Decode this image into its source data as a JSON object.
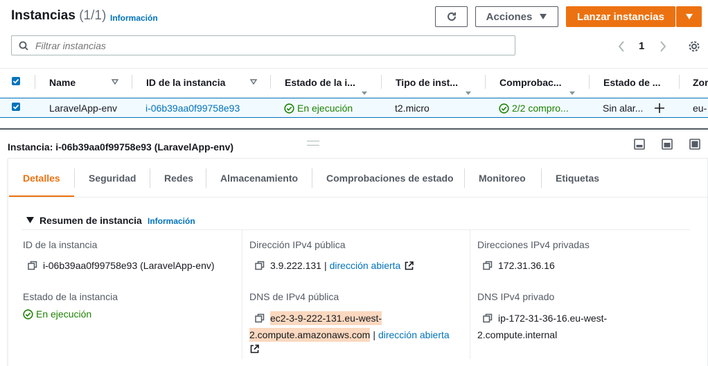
{
  "header": {
    "title": "Instancias",
    "count": "(1/1)",
    "info": "Información",
    "actions_label": "Acciones",
    "launch_label": "Lanzar instancias"
  },
  "search": {
    "placeholder": "Filtrar instancias"
  },
  "pagination": {
    "page": "1"
  },
  "table": {
    "columns": [
      "Name",
      "ID de la instancia",
      "Estado de la i...",
      "Tipo de inst...",
      "Comprobac...",
      "Estado de ...",
      "Zor"
    ],
    "row": {
      "name": "LaravelApp-env",
      "id": "i-06b39aa0f99758e93",
      "state": "En ejecución",
      "type": "t2.micro",
      "checks": "2/2 compro...",
      "alarm": "Sin alar...",
      "zone": "eu-"
    }
  },
  "detail": {
    "title": "Instancia: i-06b39aa0f99758e93 (LaravelApp-env)",
    "tabs": [
      "Detalles",
      "Seguridad",
      "Redes",
      "Almacenamiento",
      "Comprobaciones de estado",
      "Monitoreo",
      "Etiquetas"
    ],
    "summary_title": "Resumen de instancia",
    "summary_info": "Información",
    "fields": {
      "instance_id_label": "ID de la instancia",
      "instance_id_value": "i-06b39aa0f99758e93 (LaravelApp-env)",
      "public_ip_label": "Dirección IPv4 pública",
      "public_ip_value": "3.9.222.131",
      "public_ip_link": "dirección abierta",
      "private_ip_label": "Direcciones IPv4 privadas",
      "private_ip_value": "172.31.36.16",
      "state_label": "Estado de la instancia",
      "state_value": "En ejecución",
      "public_dns_label": "DNS de IPv4 pública",
      "public_dns_line1": "ec2-3-9-222-131.eu-west-",
      "public_dns_line2": "2.compute.amazonaws.com",
      "public_dns_link": "dirección abierta",
      "private_dns_label": "DNS IPv4 privado",
      "private_dns_line1": "ip-172-31-36-16.eu-west-",
      "private_dns_line2": "2.compute.internal"
    }
  },
  "colors": {
    "accent": "#ec7211",
    "link": "#0073bb",
    "success": "#1d8102"
  }
}
